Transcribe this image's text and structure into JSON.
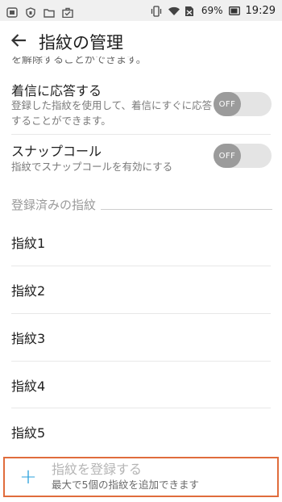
{
  "status_bar": {
    "left_icons": [
      "volume-icon",
      "shield-icon",
      "folder-icon",
      "briefcase-icon"
    ],
    "right_icons": [
      "vibrate-icon",
      "wifi-icon",
      "no-sim-icon",
      "battery-icon"
    ],
    "battery": "69%",
    "time": "19:29"
  },
  "header": {
    "back_icon": "arrow-left-icon",
    "title": "指紋の管理"
  },
  "settings": {
    "truncated_text": "を解除することができます。",
    "answer_call": {
      "title": "着信に応答する",
      "description": "登録した指紋を使用して、着信にすぐに応答することができます。",
      "toggle": "OFF"
    },
    "snap_call": {
      "title": "スナップコール",
      "description": "指紋でスナップコールを有効にする",
      "toggle": "OFF"
    }
  },
  "fingerprints": {
    "section_label": "登録済みの指紋",
    "items": [
      "指紋1",
      "指紋2",
      "指紋3",
      "指紋4",
      "指紋5"
    ]
  },
  "add_fingerprint": {
    "plus": "+",
    "title": "指紋を登録する",
    "subtitle": "最大で5個の指紋を追加できます"
  },
  "colors": {
    "accent": "#2aa1dc",
    "highlight_border": "#e06c3c",
    "toggle_off": "#9b9b9b"
  }
}
